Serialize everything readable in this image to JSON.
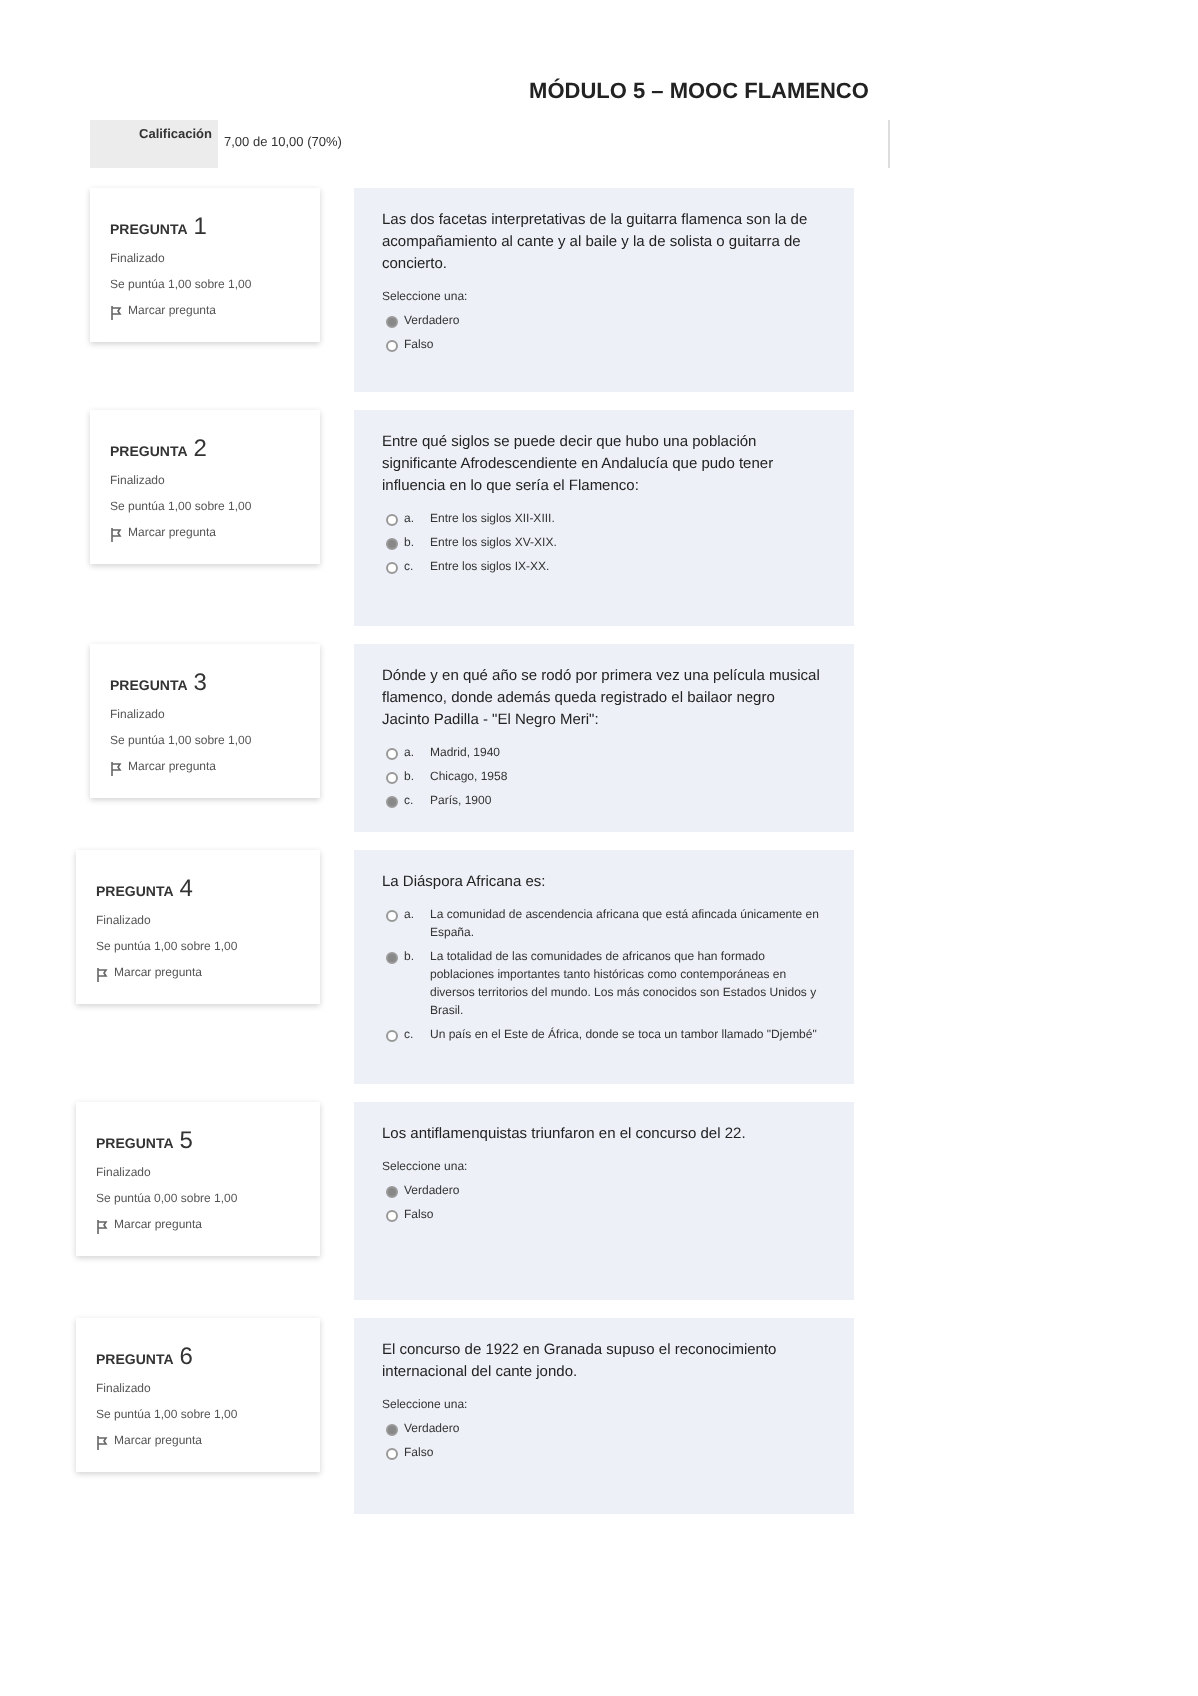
{
  "title": "MÓDULO 5 – MOOC FLAMENCO",
  "grade": {
    "label": "Calificación",
    "value": "7,00 de 10,00 (70%)"
  },
  "questions": [
    {
      "label": "PREGUNTA",
      "number": "1",
      "state": "Finalizado",
      "score": "Se puntúa 1,00 sobre 1,00",
      "flag": "Marcar pregunta",
      "text": "Las dos facetas interpretativas de la guitarra flamenca son la de acompañamiento al cante y al baile y la de solista o guitarra de concierto.",
      "prompt": "Seleccione una:",
      "options": [
        {
          "text": "Verdadero",
          "selected": true
        },
        {
          "text": "Falso",
          "selected": false
        }
      ]
    },
    {
      "label": "PREGUNTA",
      "number": "2",
      "state": "Finalizado",
      "score": "Se puntúa 1,00 sobre 1,00",
      "flag": "Marcar pregunta",
      "text": "Entre qué siglos se puede decir que hubo una población significante Afrodescendiente en Andalucía que pudo tener influencia en lo que sería el Flamenco:",
      "options": [
        {
          "letter": "a.",
          "text": "Entre los siglos XII-XIII.",
          "selected": false
        },
        {
          "letter": "b.",
          "text": "Entre los siglos XV-XIX.",
          "selected": true
        },
        {
          "letter": "c.",
          "text": "Entre los siglos IX-XX.",
          "selected": false
        }
      ]
    },
    {
      "label": "PREGUNTA",
      "number": "3",
      "state": "Finalizado",
      "score": "Se puntúa 1,00 sobre 1,00",
      "flag": "Marcar pregunta",
      "text": "Dónde y en qué año se rodó por primera vez una película musical flamenco, donde además queda registrado el bailaor negro Jacinto Padilla - \"El Negro Meri\":",
      "options": [
        {
          "letter": "a.",
          "text": "Madrid, 1940",
          "selected": false
        },
        {
          "letter": "b.",
          "text": "Chicago, 1958",
          "selected": false
        },
        {
          "letter": "c.",
          "text": "París, 1900",
          "selected": true
        }
      ]
    },
    {
      "label": "PREGUNTA",
      "number": "4",
      "state": "Finalizado",
      "score": "Se puntúa 1,00 sobre 1,00",
      "flag": "Marcar pregunta",
      "text": "La Diáspora Africana es:",
      "options": [
        {
          "letter": "a.",
          "text": "La comunidad de ascendencia africana que está afincada únicamente en España.",
          "selected": false
        },
        {
          "letter": "b.",
          "text": "La totalidad de las comunidades de africanos que han formado poblaciones importantes tanto históricas como contemporáneas en diversos territorios del mundo. Los más conocidos son Estados Unidos y Brasil.",
          "selected": true
        },
        {
          "letter": "c.",
          "text": "Un país en el Este de África, donde se toca un tambor llamado \"Djembé\"",
          "selected": false
        }
      ]
    },
    {
      "label": "PREGUNTA",
      "number": "5",
      "state": "Finalizado",
      "score": "Se puntúa 0,00 sobre 1,00",
      "flag": "Marcar pregunta",
      "text": "Los antiflamenquistas triunfaron en el concurso del 22.",
      "prompt": "Seleccione una:",
      "options": [
        {
          "text": "Verdadero",
          "selected": true
        },
        {
          "text": "Falso",
          "selected": false
        }
      ]
    },
    {
      "label": "PREGUNTA",
      "number": "6",
      "state": "Finalizado",
      "score": "Se puntúa 1,00 sobre 1,00",
      "flag": "Marcar pregunta",
      "text": "El concurso de 1922 en Granada supuso el reconocimiento internacional del cante jondo.",
      "prompt": "Seleccione una:",
      "options": [
        {
          "text": "Verdadero",
          "selected": true
        },
        {
          "text": "Falso",
          "selected": false
        }
      ]
    }
  ]
}
